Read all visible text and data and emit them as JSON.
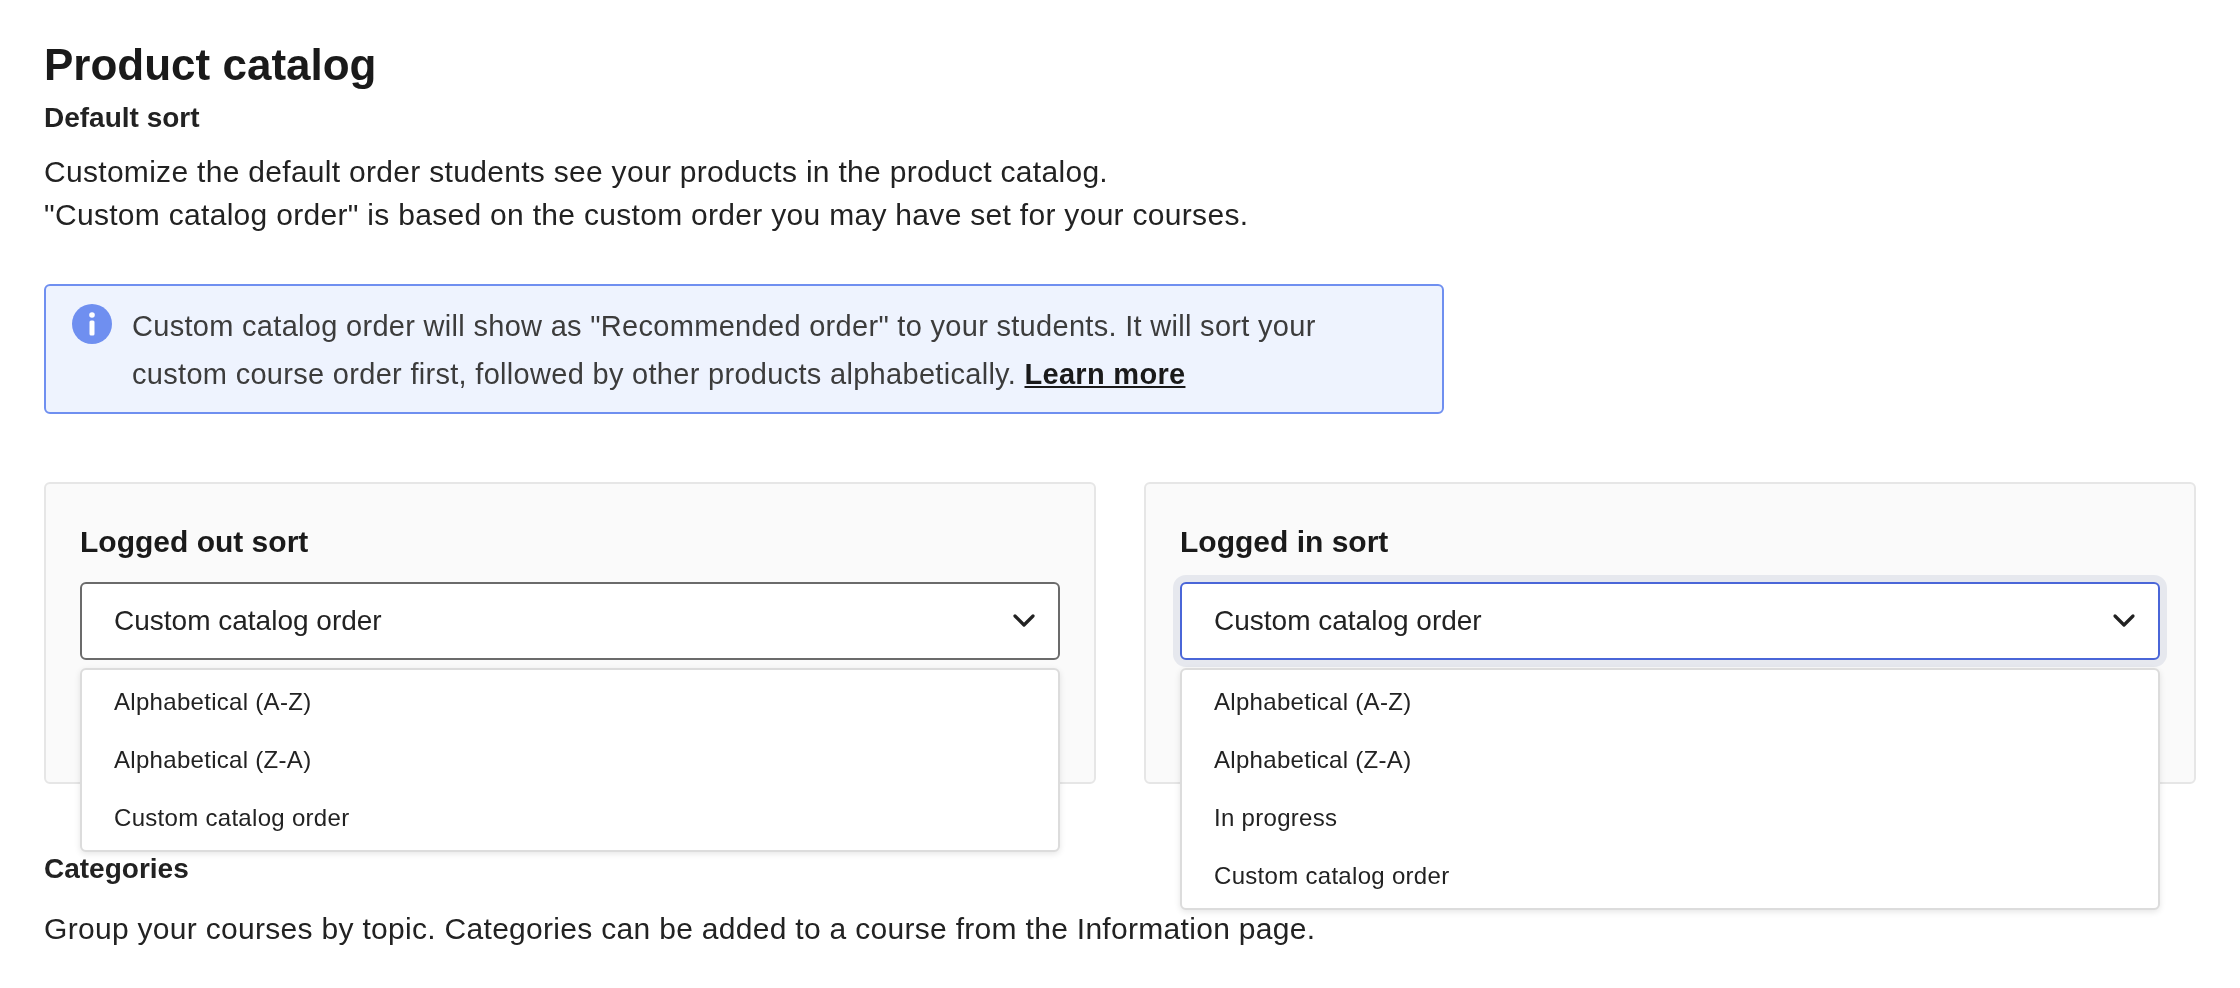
{
  "page": {
    "title": "Product catalog"
  },
  "default_sort": {
    "heading": "Default sort",
    "description": [
      "Customize the default order students see your products in the product catalog.",
      "\"Custom catalog order\" is based on the custom order you may have set for your courses."
    ],
    "info": {
      "text": "Custom catalog order will show as \"Recommended order\" to your students. It will sort your custom course order first, followed by other products alphabetically.",
      "link": "Learn more"
    },
    "cards": [
      {
        "title": "Logged out sort",
        "select": {
          "value": "Custom catalog order",
          "focused": false,
          "open": true,
          "options": [
            "Alphabetical (A-Z)",
            "Alphabetical (Z-A)",
            "Custom catalog order"
          ]
        }
      },
      {
        "title": "Logged in sort",
        "select": {
          "value": "Custom catalog order",
          "focused": true,
          "open": true,
          "options": [
            "Alphabetical (A-Z)",
            "Alphabetical (Z-A)",
            "In progress",
            "Custom catalog order"
          ]
        }
      }
    ]
  },
  "categories": {
    "heading": "Categories",
    "description": "Group your courses by topic. Categories can be added to a course from the Information page."
  }
}
